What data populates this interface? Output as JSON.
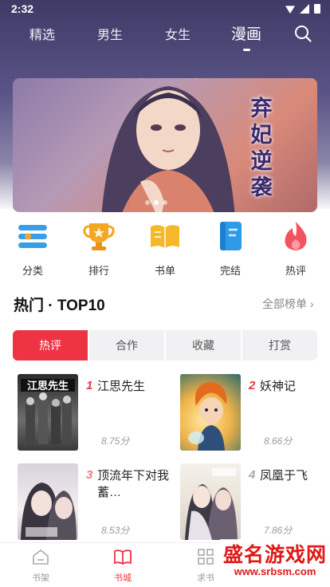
{
  "status": {
    "time": "2:32"
  },
  "tabs": [
    {
      "label": "精选"
    },
    {
      "label": "男生"
    },
    {
      "label": "女生"
    },
    {
      "label": "漫画"
    }
  ],
  "active_tab": "漫画",
  "banner": {
    "title": "弃妃逆袭",
    "dots": 3,
    "active_dot": 1
  },
  "categories": [
    {
      "label": "分类",
      "icon": "category-icon"
    },
    {
      "label": "排行",
      "icon": "trophy-icon"
    },
    {
      "label": "书单",
      "icon": "book-list-icon"
    },
    {
      "label": "完结",
      "icon": "finished-book-icon"
    },
    {
      "label": "热评",
      "icon": "flame-icon"
    }
  ],
  "section": {
    "title": "热门 · TOP10",
    "more": "全部榜单 ›"
  },
  "segments": [
    {
      "label": "热评",
      "active": true
    },
    {
      "label": "合作",
      "active": false
    },
    {
      "label": "收藏",
      "active": false
    },
    {
      "label": "打赏",
      "active": false
    }
  ],
  "books": [
    {
      "rank": "1",
      "name": "江思先生",
      "score": "8.75分",
      "rank_color": "#ee3343"
    },
    {
      "rank": "2",
      "name": "妖神记",
      "score": "8.66分",
      "rank_color": "#ee3343"
    },
    {
      "rank": "3",
      "name": "顶流年下对我蓄…",
      "score": "8.53分",
      "rank_color": "#f07a80"
    },
    {
      "rank": "4",
      "name": "凤凰于飞",
      "score": "7.86分",
      "rank_color": "#aaaaaa"
    }
  ],
  "bottom_nav": [
    {
      "label": "书架",
      "icon": "bookshelf-icon",
      "active": false
    },
    {
      "label": "书城",
      "icon": "bookstore-icon",
      "active": true
    },
    {
      "label": "求书",
      "icon": "request-grid-icon",
      "active": false
    }
  ],
  "watermark": {
    "title": "盛名游戏网",
    "url": "www.srbsm.com"
  },
  "colors": {
    "accent": "#ee3343",
    "header": "#4b4577"
  }
}
